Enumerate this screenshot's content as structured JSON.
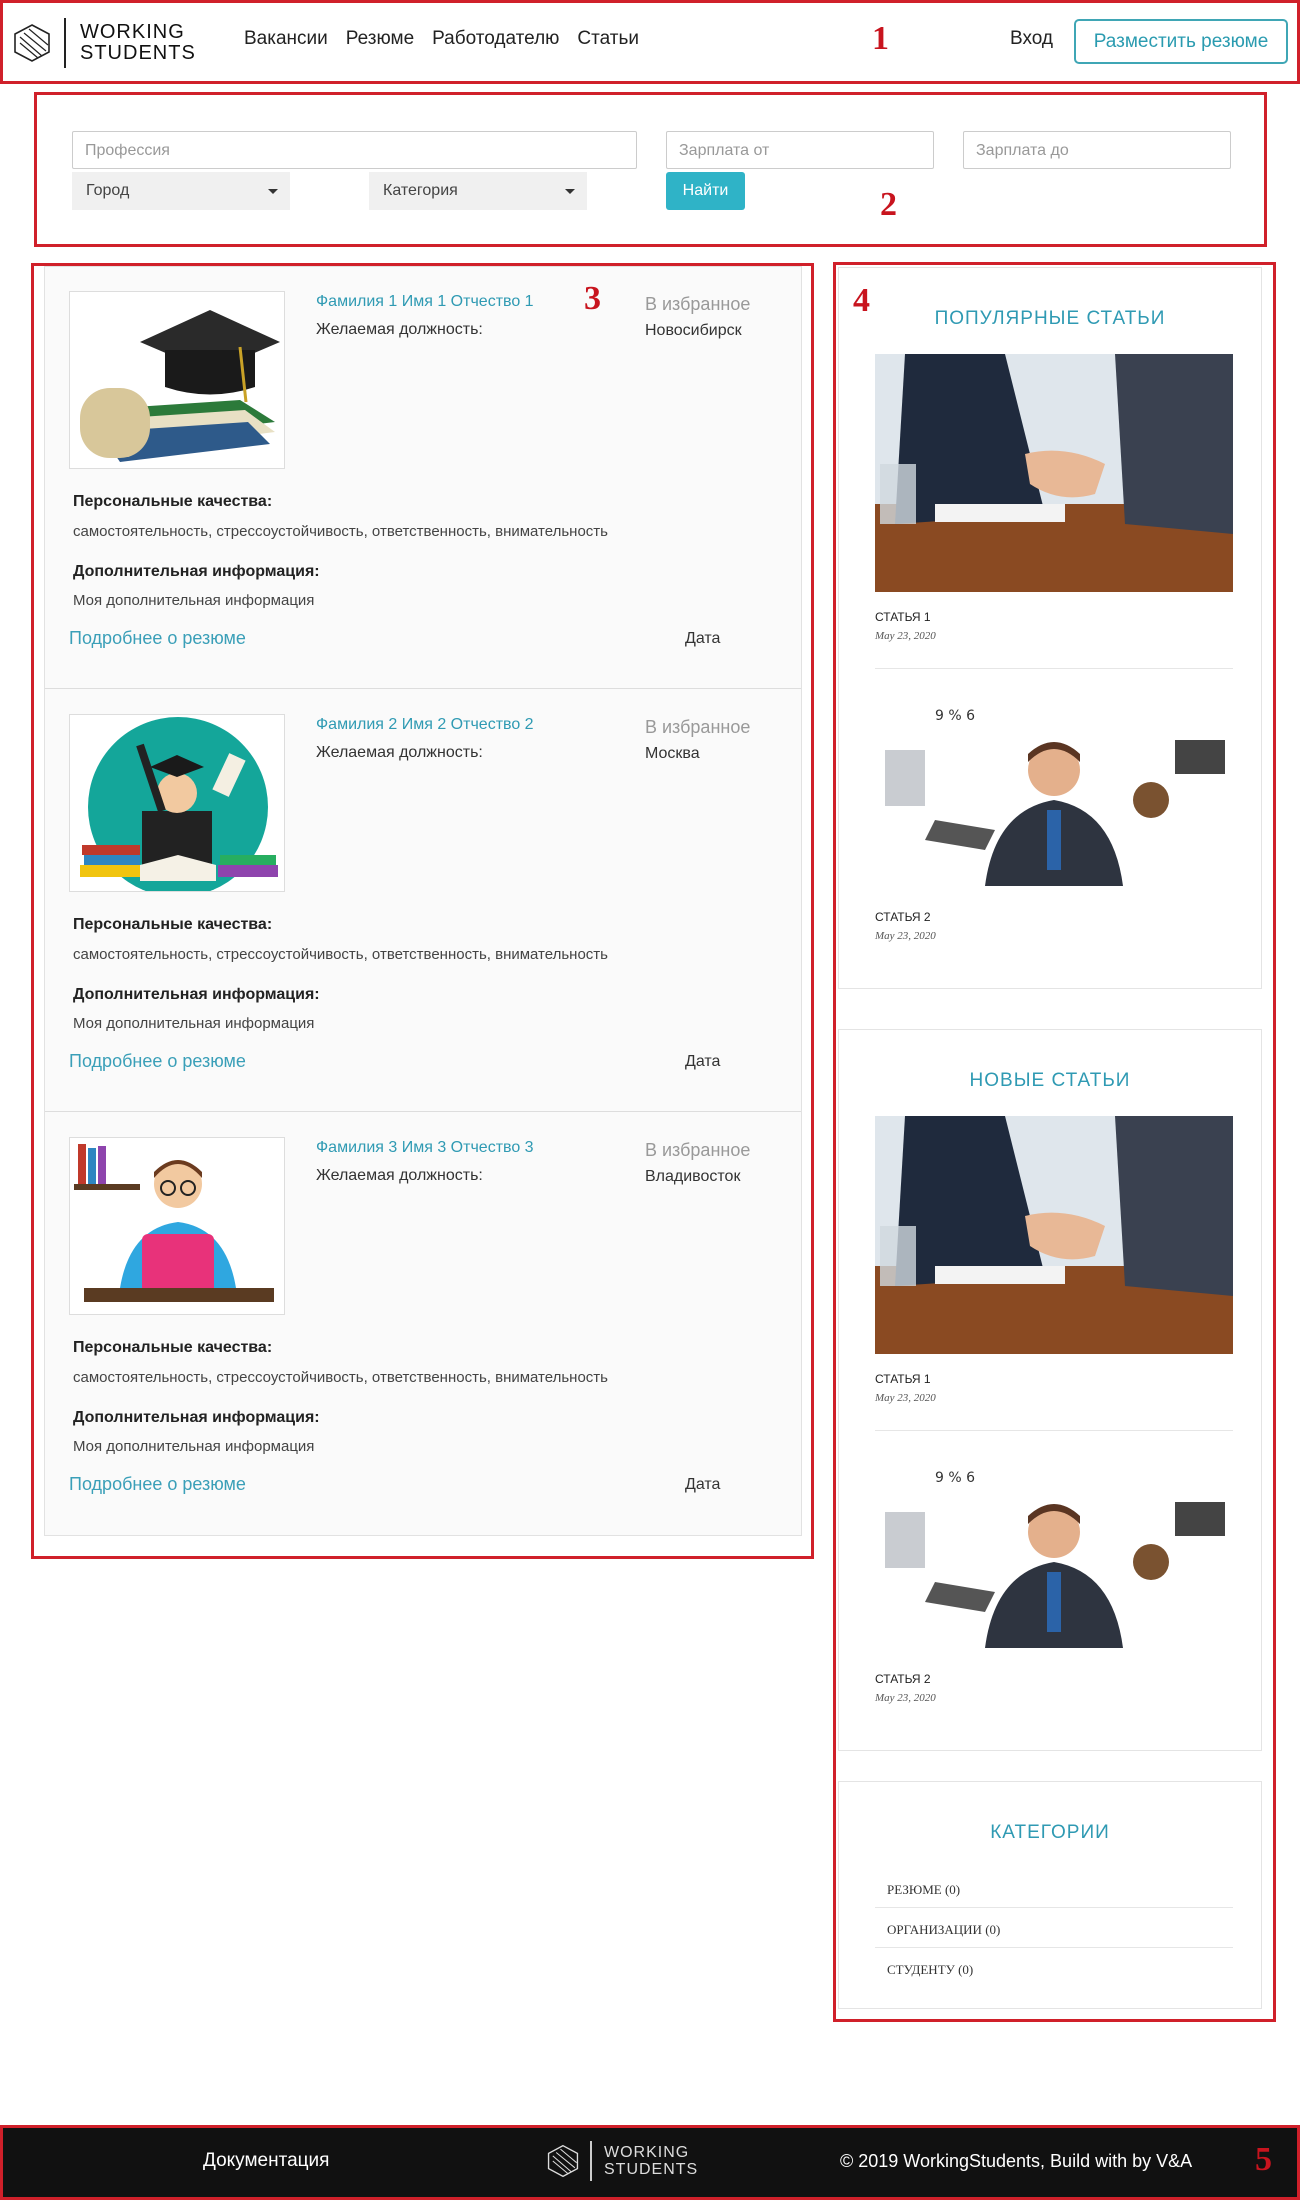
{
  "header": {
    "logo_line1": "WORKING",
    "logo_line2": "STUDENTS",
    "nav": [
      "Вакансии",
      "Резюме",
      "Работодателю",
      "Статьи"
    ],
    "login": "Вход",
    "post_resume": "Разместить резюме"
  },
  "filter": {
    "profession_placeholder": "Профессия",
    "salary_from_placeholder": "Зарплата от",
    "salary_to_placeholder": "Зарплата до",
    "city": "Город",
    "category": "Категория",
    "find": "Найти"
  },
  "resumes": [
    {
      "name": "Фамилия 1 Имя 1 Отчество 1",
      "position_label": "Желаемая должность:",
      "favorite": "В избранное",
      "city": "Новосибирск",
      "qualities_label": "Персональные качества:",
      "qualities": "самостоятельность, стрессоустойчивость, ответственность, внимательность",
      "extra_label": "Дополнительная информация:",
      "extra": "Моя дополнительная информация",
      "more": "Подробнее о резюме",
      "date": "Дата"
    },
    {
      "name": "Фамилия 2 Имя 2 Отчество 2",
      "position_label": "Желаемая должность:",
      "favorite": "В избранное",
      "city": "Москва",
      "qualities_label": "Персональные качества:",
      "qualities": "самостоятельность, стрессоустойчивость, ответственность, внимательность",
      "extra_label": "Дополнительная информация:",
      "extra": "Моя дополнительная информация",
      "more": "Подробнее о резюме",
      "date": "Дата"
    },
    {
      "name": "Фамилия 3 Имя 3 Отчество 3",
      "position_label": "Желаемая должность:",
      "favorite": "В избранное",
      "city": "Владивосток",
      "qualities_label": "Персональные качества:",
      "qualities": "самостоятельность, стрессоустойчивость, ответственность, внимательность",
      "extra_label": "Дополнительная информация:",
      "extra": "Моя дополнительная информация",
      "more": "Подробнее о резюме",
      "date": "Дата"
    }
  ],
  "sidebar": {
    "popular_title": "ПОПУЛЯРНЫЕ СТАТЬИ",
    "popular": [
      {
        "title": "СТАТЬЯ 1",
        "date": "May 23, 2020"
      },
      {
        "title": "СТАТЬЯ 2",
        "date": "May 23, 2020"
      }
    ],
    "new_title": "НОВЫЕ СТАТЬИ",
    "new": [
      {
        "title": "СТАТЬЯ 1",
        "date": "May 23, 2020"
      },
      {
        "title": "СТАТЬЯ 2",
        "date": "May 23, 2020"
      }
    ],
    "categories_title": "КАТЕГОРИИ",
    "categories": [
      "РЕЗЮМЕ (0)",
      "ОРГАНИЗАЦИИ (0)",
      "СТУДЕНТУ (0)"
    ]
  },
  "footer": {
    "docs": "Документация",
    "logo_line1": "WORKING",
    "logo_line2": "STUDENTS",
    "copyright": "© 2019 WorkingStudents, Build with by V&A"
  },
  "annotations": [
    "1",
    "2",
    "3",
    "4",
    "5"
  ],
  "colors": {
    "accent": "#2f9ab3",
    "button": "#2fb3c7",
    "annotation": "#d0202a",
    "footer_bg": "#111111"
  }
}
